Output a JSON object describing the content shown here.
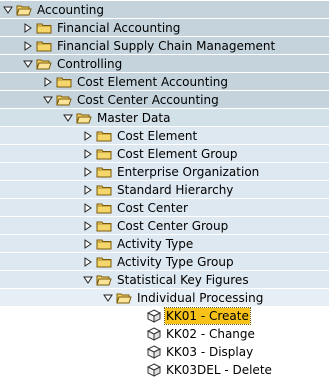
{
  "tree": [
    {
      "label": "Accounting",
      "level": 0,
      "kind": "folder",
      "expanded": true
    },
    {
      "label": "Financial Accounting",
      "level": 1,
      "kind": "folder",
      "expanded": false
    },
    {
      "label": "Financial Supply Chain Management",
      "level": 1,
      "kind": "folder",
      "expanded": false
    },
    {
      "label": "Controlling",
      "level": 1,
      "kind": "folder",
      "expanded": true
    },
    {
      "label": "Cost Element Accounting",
      "level": 2,
      "kind": "folder",
      "expanded": false
    },
    {
      "label": "Cost Center Accounting",
      "level": 2,
      "kind": "folder",
      "expanded": true
    },
    {
      "label": "Master Data",
      "level": 3,
      "kind": "folder",
      "expanded": true
    },
    {
      "label": "Cost Element",
      "level": 4,
      "kind": "folder",
      "expanded": false
    },
    {
      "label": "Cost Element Group",
      "level": 4,
      "kind": "folder",
      "expanded": false
    },
    {
      "label": "Enterprise Organization",
      "level": 4,
      "kind": "folder",
      "expanded": false
    },
    {
      "label": "Standard Hierarchy",
      "level": 4,
      "kind": "folder",
      "expanded": false
    },
    {
      "label": "Cost Center",
      "level": 4,
      "kind": "folder",
      "expanded": false
    },
    {
      "label": "Cost Center Group",
      "level": 4,
      "kind": "folder",
      "expanded": false
    },
    {
      "label": "Activity Type",
      "level": 4,
      "kind": "folder",
      "expanded": false
    },
    {
      "label": "Activity Type Group",
      "level": 4,
      "kind": "folder",
      "expanded": false
    },
    {
      "label": "Statistical Key Figures",
      "level": 4,
      "kind": "folder",
      "expanded": true
    },
    {
      "label": "Individual Processing",
      "level": 5,
      "kind": "folder",
      "expanded": true
    },
    {
      "label": "KK01 - Create",
      "level": 6,
      "kind": "transaction",
      "selected": true
    },
    {
      "label": "KK02 - Change",
      "level": 6,
      "kind": "transaction",
      "selected": false
    },
    {
      "label": "KK03 - Display",
      "level": 6,
      "kind": "transaction",
      "selected": false
    },
    {
      "label": "KK03DEL - Delete",
      "level": 6,
      "kind": "transaction",
      "selected": false
    }
  ],
  "colors": {
    "selection": "#f6c21a",
    "folder_fill": "#f5d66b",
    "folder_stroke": "#7a5a08"
  }
}
